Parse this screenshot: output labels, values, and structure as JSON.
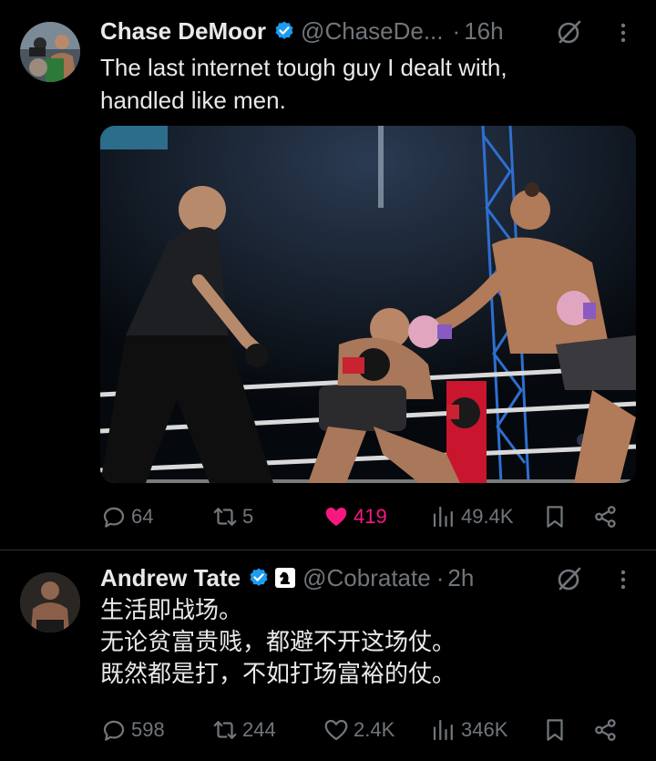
{
  "tweets": [
    {
      "author_name": "Chase DeMoor",
      "handle": "@ChaseDe...",
      "time": "16h",
      "lines": [
        "The last internet tough guy I dealt with,",
        "handled like men."
      ],
      "stats": {
        "replies": "64",
        "reposts": "5",
        "likes": "419",
        "views": "49.4K"
      },
      "liked": true
    },
    {
      "author_name": "Andrew Tate",
      "handle": "@Cobratate",
      "time": "2h",
      "lines": [
        "生活即战场。",
        "无论贫富贵贱，都避不开这场仗。",
        "既然都是打，不如打场富裕的仗。"
      ],
      "stats": {
        "replies": "598",
        "reposts": "244",
        "likes": "2.4K",
        "views": "346K"
      },
      "liked": false
    }
  ],
  "icons": {
    "verified": "verified-badge-icon",
    "org": "chess-knight-icon",
    "grok": "grok-icon",
    "more": "more-vertical-icon",
    "reply": "reply-icon",
    "repost": "repost-icon",
    "like": "heart-icon",
    "views": "views-icon",
    "bookmark": "bookmark-icon",
    "share": "share-icon"
  },
  "colors": {
    "background": "#000000",
    "text": "#e7e9ea",
    "muted": "#71767b",
    "verified": "#1d9bf0",
    "liked": "#f91880",
    "divider": "#2f3336"
  }
}
